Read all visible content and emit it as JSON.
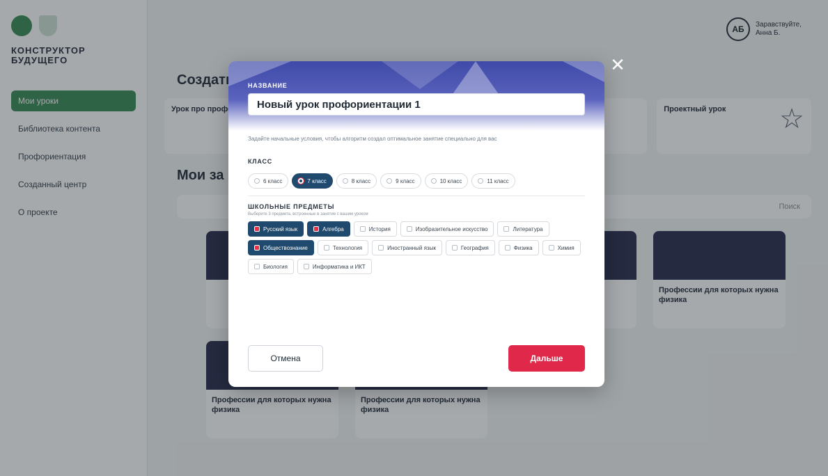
{
  "user": {
    "initials": "АБ",
    "name": "Заравствуйте, Анна Б."
  },
  "sidebar": {
    "logo_line1": "КОНСТРУКТОР",
    "logo_line2": "БУДУЩЕГО",
    "items": [
      {
        "label": "Мои уроки",
        "active": true
      },
      {
        "label": "Библиотека контента",
        "active": false
      },
      {
        "label": "Профориентация",
        "active": false
      },
      {
        "label": "Созданный центр",
        "active": false
      },
      {
        "label": "О проекте",
        "active": false
      }
    ]
  },
  "background": {
    "create_title": "Создать",
    "cards": [
      {
        "title": "Урок про профессию",
        "sub": ""
      },
      {
        "title": "",
        "sub": ""
      },
      {
        "title": "",
        "sub": ""
      },
      {
        "title": "Проектный урок",
        "sub": ""
      }
    ],
    "my_title": "Мои за",
    "search_label": "Поиск",
    "lessons": [
      {
        "title": ""
      },
      {
        "title": ""
      },
      {
        "title": ""
      },
      {
        "title": "Профессии для которых нужна физика"
      },
      {
        "title": "Профессии для которых нужна физика"
      },
      {
        "title": "Профессии для которых нужна физика"
      }
    ]
  },
  "modal": {
    "name_label": "НАЗВАНИЕ",
    "name_value": "Новый урок профориентации 1",
    "hint": "Задайте начальные условия, чтобы алгоритм создал оптимальное занятие специально для вас",
    "grade_title": "КЛАСС",
    "grades": [
      {
        "label": "6 класс",
        "selected": false
      },
      {
        "label": "7 класс",
        "selected": true
      },
      {
        "label": "8 класс",
        "selected": false
      },
      {
        "label": "9 класс",
        "selected": false
      },
      {
        "label": "10 класс",
        "selected": false
      },
      {
        "label": "11 класс",
        "selected": false
      }
    ],
    "subjects_title": "ШКОЛЬНЫЕ ПРЕДМЕТЫ",
    "subjects_sub": "Выберите 3 предмета, встроенные в занятие с вашим уроком",
    "subjects": [
      {
        "label": "Русский язык",
        "selected": true
      },
      {
        "label": "Алгебра",
        "selected": true
      },
      {
        "label": "История",
        "selected": false
      },
      {
        "label": "Изобразительное искусство",
        "selected": false
      },
      {
        "label": "Литература",
        "selected": false
      },
      {
        "label": "Обществознание",
        "selected": true
      },
      {
        "label": "Технология",
        "selected": false
      },
      {
        "label": "Иностранный язык",
        "selected": false
      },
      {
        "label": "География",
        "selected": false
      },
      {
        "label": "Физика",
        "selected": false
      },
      {
        "label": "Химия",
        "selected": false
      },
      {
        "label": "Биология",
        "selected": false
      },
      {
        "label": "Информатика и ИКТ",
        "selected": false
      }
    ],
    "cancel_label": "Отмена",
    "next_label": "Дальше",
    "close_glyph": "✕"
  },
  "colors": {
    "accent_red": "#e0294a",
    "selected_chip": "#1f4a6e",
    "brand_green": "#3f8f5a",
    "header_blue": "#3f4aa8"
  }
}
